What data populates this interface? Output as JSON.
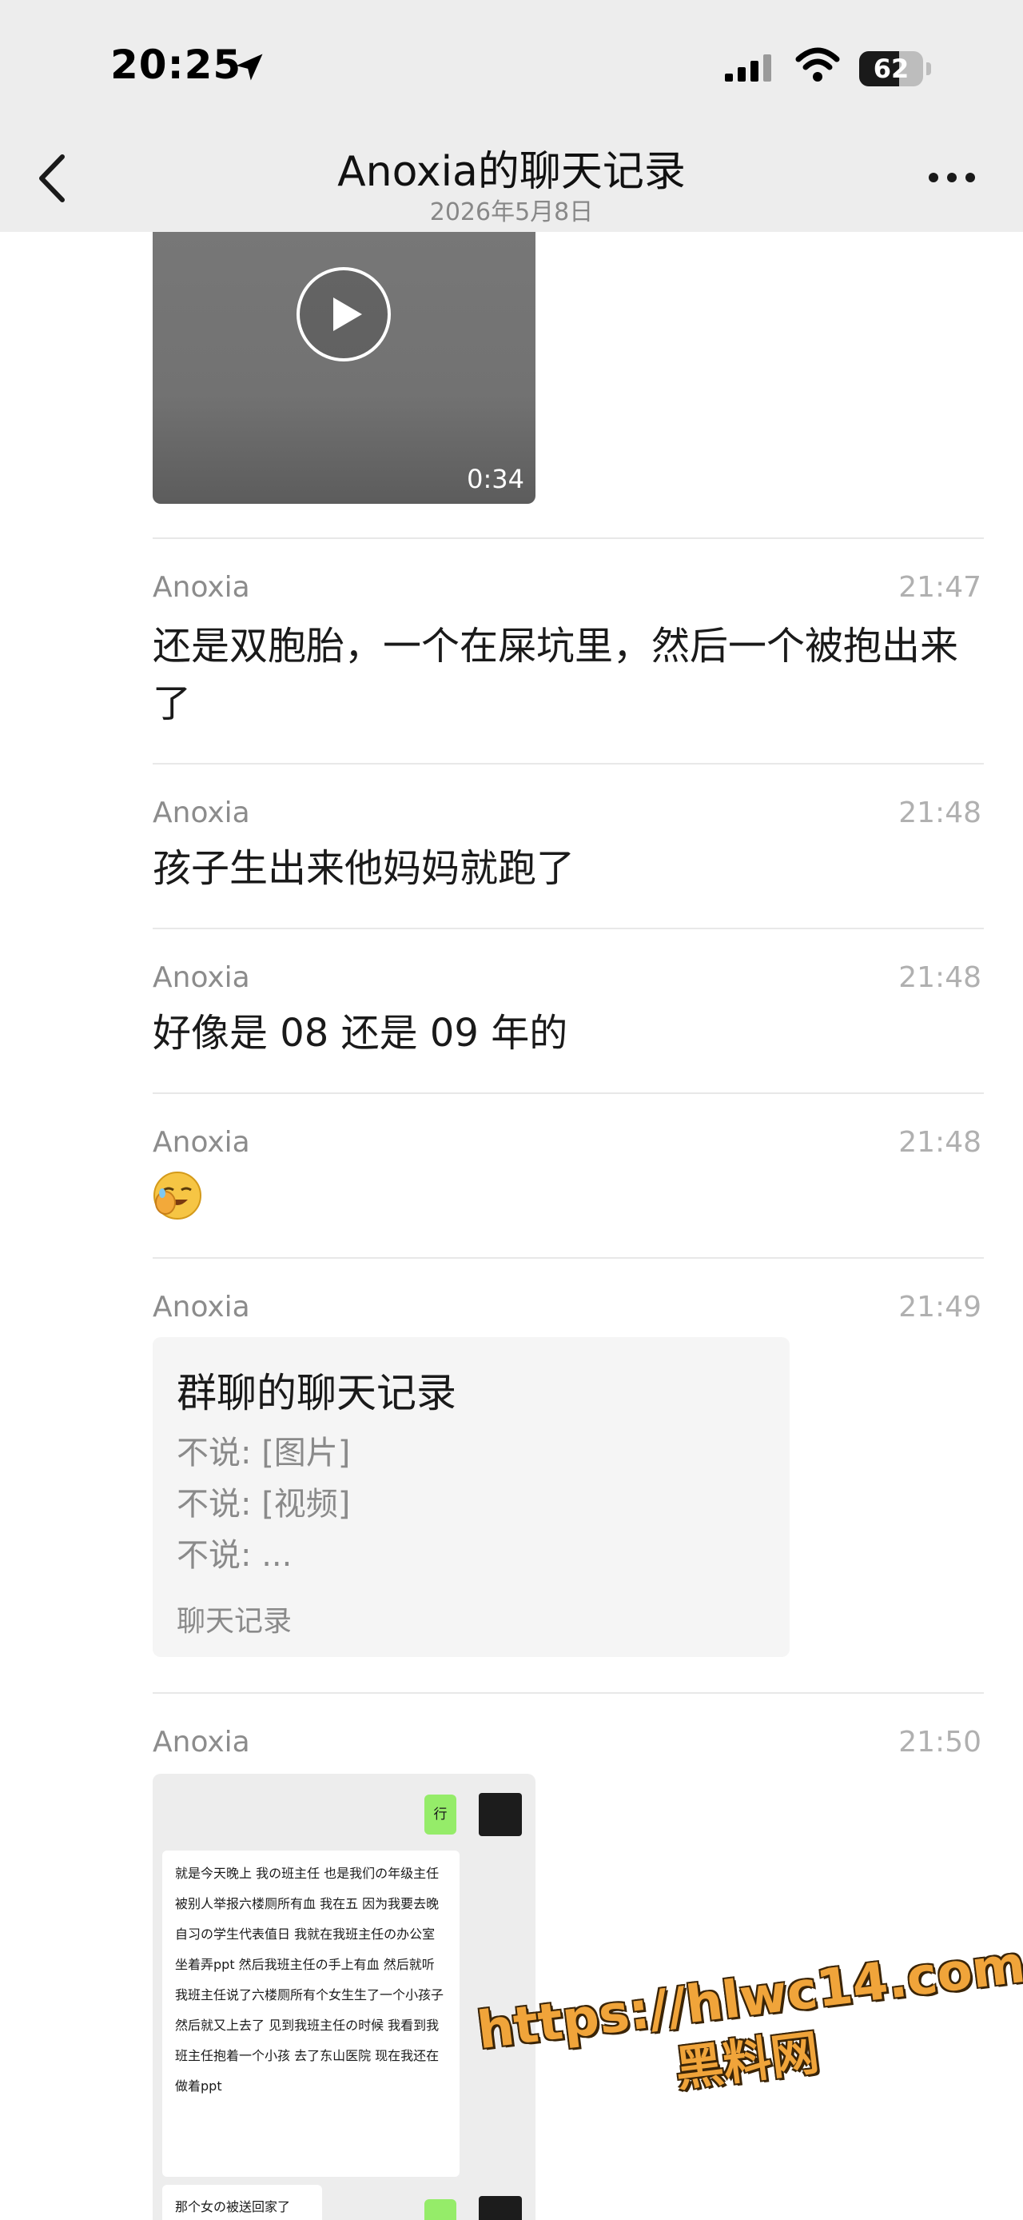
{
  "status_bar": {
    "time": "20:25",
    "battery": "62",
    "battery_level_percent": 62
  },
  "nav": {
    "title": "Anoxia的聊天记录",
    "subtitle": "2026年5月8日"
  },
  "video": {
    "duration": "0:34"
  },
  "messages": [
    {
      "sender": "Anoxia",
      "time": "21:47",
      "text": "还是双胞胎，一个在屎坑里，然后一个被抱出来了"
    },
    {
      "sender": "Anoxia",
      "time": "21:48",
      "text": "孩子生出来他妈妈就跑了"
    },
    {
      "sender": "Anoxia",
      "time": "21:48",
      "text": "好像是 08 还是 09 年的"
    },
    {
      "sender": "Anoxia",
      "time": "21:48",
      "emoji": "facepalm-laugh-emoji"
    },
    {
      "sender": "Anoxia",
      "time": "21:49"
    },
    {
      "sender": "Anoxia",
      "time": "21:50"
    }
  ],
  "chat_record_card": {
    "title": "群聊的聊天记录",
    "lines": [
      "不说: [图片]",
      "不说: [视频]",
      "不说: ..."
    ],
    "footer": "聊天记录"
  },
  "embedded_screenshot": {
    "reply_1": "行",
    "long_message": "就是今天晚上 我の班主任 也是我们の年级主任 被别人举报六楼厕所有血 我在五 因为我要去晚自习の学生代表值日 我就在我班主任の办公室坐着弄ppt 然后我班主任の手上有血 然后就听我班主任说了六楼厕所有个女生生了一个小孩子 然后就又上去了 见到我班主任の时候 我看到我班主任抱着一个小孩 去了东山医院 现在我还在做着ppt",
    "short_message": "那个女の被送回家了"
  },
  "watermark": {
    "url": "https://hlwc14.com",
    "name": "黑料网"
  },
  "colors": {
    "bar_bg": "#ededed",
    "sender": "#8c8c8c",
    "timestamp": "#b0b0b0",
    "wechat_green": "#95ec69",
    "watermark": "#f0a43a"
  }
}
